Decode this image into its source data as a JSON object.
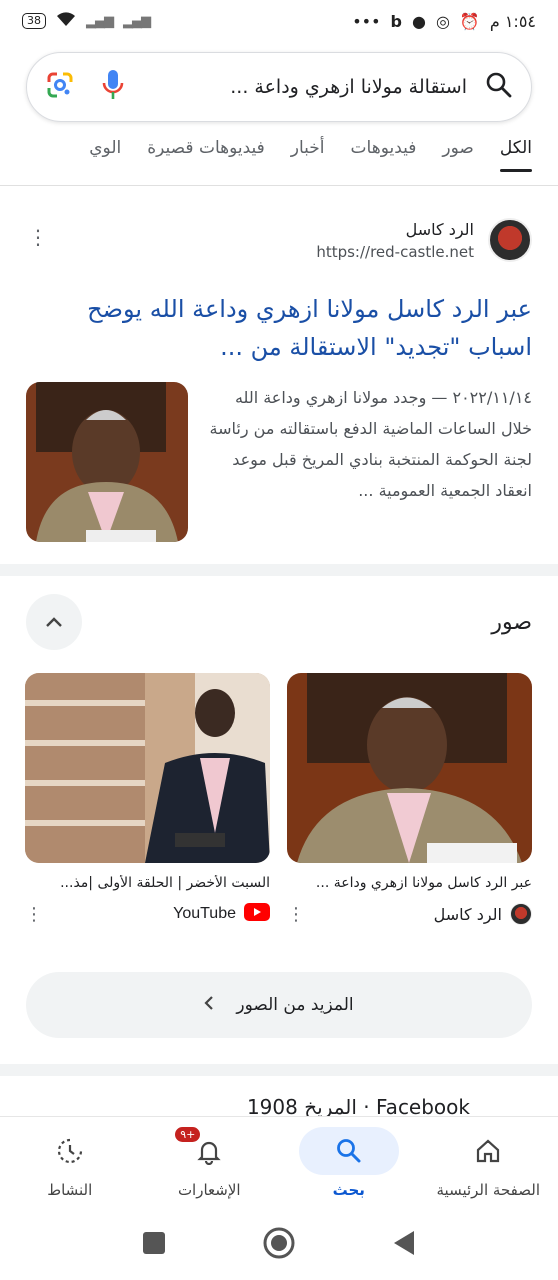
{
  "status_bar": {
    "time": "١:٥٤ م",
    "battery": "38",
    "more": "•••"
  },
  "search": {
    "query": "استقالة مولانا ازهري وداعة ..."
  },
  "tabs": [
    "الكل",
    "صور",
    "فيديوهات",
    "أخبار",
    "فيديوهات قصيرة",
    "الوي"
  ],
  "result": {
    "site_name": "الرد كاسل",
    "site_url": "https://red-castle.net",
    "title": "عبر الرد كاسل مولانا ازهري وداعة الله يوضح اسباب \"تجديد\" الاستقالة من ...",
    "snippet": "٢٠٢٢/١١/١٤ — وجدد مولانا ازهري وداعة الله خلال الساعات الماضية الدفع باستقالته من رئاسة لجنة الحوكمة المنتخبة بنادي المريخ قبل موعد انعقاد الجمعية العمومية ..."
  },
  "images_section": {
    "heading": "صور",
    "cards": [
      {
        "caption": "عبر الرد كاسل مولانا ازهري وداعة ...",
        "source": "الرد كاسل"
      },
      {
        "caption": "السبت الأخضر | الحلقة الأولى |مذ...",
        "source": "YouTube"
      }
    ],
    "more_label": "المزيد من الصور"
  },
  "peek_text": "Facebook · المريخ 1908",
  "bottom_nav": [
    {
      "label": "الصفحة الرئيسية",
      "icon": "home-icon"
    },
    {
      "label": "بحث",
      "icon": "search-icon",
      "active": true
    },
    {
      "label": "الإشعارات",
      "icon": "bell-icon",
      "badge": "+٩"
    },
    {
      "label": "النشاط",
      "icon": "activity-icon"
    }
  ],
  "colors": {
    "link": "#1a4fa6",
    "active_nav": "#0b57d0",
    "badge": "#c5221f"
  }
}
